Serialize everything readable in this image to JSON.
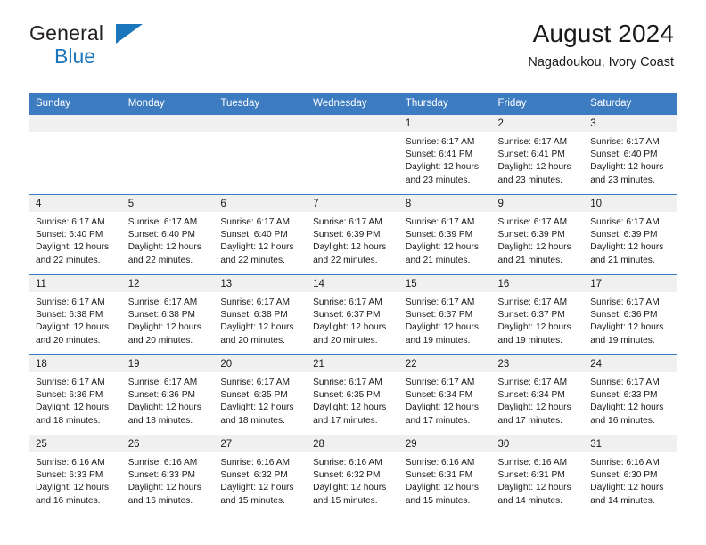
{
  "brand": {
    "name_part1": "General",
    "name_part2": "Blue"
  },
  "header": {
    "title": "August 2024",
    "location": "Nagadoukou, Ivory Coast"
  },
  "colors": {
    "header_blue": "#3e7cc1",
    "brand_blue": "#1b76bc",
    "daynum_band": "#f0f0f0"
  },
  "weekday_headers": [
    "Sunday",
    "Monday",
    "Tuesday",
    "Wednesday",
    "Thursday",
    "Friday",
    "Saturday"
  ],
  "weeks": [
    [
      {
        "day": "",
        "sunrise": "",
        "sunset": "",
        "daylight1": "",
        "daylight2": ""
      },
      {
        "day": "",
        "sunrise": "",
        "sunset": "",
        "daylight1": "",
        "daylight2": ""
      },
      {
        "day": "",
        "sunrise": "",
        "sunset": "",
        "daylight1": "",
        "daylight2": ""
      },
      {
        "day": "",
        "sunrise": "",
        "sunset": "",
        "daylight1": "",
        "daylight2": ""
      },
      {
        "day": "1",
        "sunrise": "Sunrise: 6:17 AM",
        "sunset": "Sunset: 6:41 PM",
        "daylight1": "Daylight: 12 hours",
        "daylight2": "and 23 minutes."
      },
      {
        "day": "2",
        "sunrise": "Sunrise: 6:17 AM",
        "sunset": "Sunset: 6:41 PM",
        "daylight1": "Daylight: 12 hours",
        "daylight2": "and 23 minutes."
      },
      {
        "day": "3",
        "sunrise": "Sunrise: 6:17 AM",
        "sunset": "Sunset: 6:40 PM",
        "daylight1": "Daylight: 12 hours",
        "daylight2": "and 23 minutes."
      }
    ],
    [
      {
        "day": "4",
        "sunrise": "Sunrise: 6:17 AM",
        "sunset": "Sunset: 6:40 PM",
        "daylight1": "Daylight: 12 hours",
        "daylight2": "and 22 minutes."
      },
      {
        "day": "5",
        "sunrise": "Sunrise: 6:17 AM",
        "sunset": "Sunset: 6:40 PM",
        "daylight1": "Daylight: 12 hours",
        "daylight2": "and 22 minutes."
      },
      {
        "day": "6",
        "sunrise": "Sunrise: 6:17 AM",
        "sunset": "Sunset: 6:40 PM",
        "daylight1": "Daylight: 12 hours",
        "daylight2": "and 22 minutes."
      },
      {
        "day": "7",
        "sunrise": "Sunrise: 6:17 AM",
        "sunset": "Sunset: 6:39 PM",
        "daylight1": "Daylight: 12 hours",
        "daylight2": "and 22 minutes."
      },
      {
        "day": "8",
        "sunrise": "Sunrise: 6:17 AM",
        "sunset": "Sunset: 6:39 PM",
        "daylight1": "Daylight: 12 hours",
        "daylight2": "and 21 minutes."
      },
      {
        "day": "9",
        "sunrise": "Sunrise: 6:17 AM",
        "sunset": "Sunset: 6:39 PM",
        "daylight1": "Daylight: 12 hours",
        "daylight2": "and 21 minutes."
      },
      {
        "day": "10",
        "sunrise": "Sunrise: 6:17 AM",
        "sunset": "Sunset: 6:39 PM",
        "daylight1": "Daylight: 12 hours",
        "daylight2": "and 21 minutes."
      }
    ],
    [
      {
        "day": "11",
        "sunrise": "Sunrise: 6:17 AM",
        "sunset": "Sunset: 6:38 PM",
        "daylight1": "Daylight: 12 hours",
        "daylight2": "and 20 minutes."
      },
      {
        "day": "12",
        "sunrise": "Sunrise: 6:17 AM",
        "sunset": "Sunset: 6:38 PM",
        "daylight1": "Daylight: 12 hours",
        "daylight2": "and 20 minutes."
      },
      {
        "day": "13",
        "sunrise": "Sunrise: 6:17 AM",
        "sunset": "Sunset: 6:38 PM",
        "daylight1": "Daylight: 12 hours",
        "daylight2": "and 20 minutes."
      },
      {
        "day": "14",
        "sunrise": "Sunrise: 6:17 AM",
        "sunset": "Sunset: 6:37 PM",
        "daylight1": "Daylight: 12 hours",
        "daylight2": "and 20 minutes."
      },
      {
        "day": "15",
        "sunrise": "Sunrise: 6:17 AM",
        "sunset": "Sunset: 6:37 PM",
        "daylight1": "Daylight: 12 hours",
        "daylight2": "and 19 minutes."
      },
      {
        "day": "16",
        "sunrise": "Sunrise: 6:17 AM",
        "sunset": "Sunset: 6:37 PM",
        "daylight1": "Daylight: 12 hours",
        "daylight2": "and 19 minutes."
      },
      {
        "day": "17",
        "sunrise": "Sunrise: 6:17 AM",
        "sunset": "Sunset: 6:36 PM",
        "daylight1": "Daylight: 12 hours",
        "daylight2": "and 19 minutes."
      }
    ],
    [
      {
        "day": "18",
        "sunrise": "Sunrise: 6:17 AM",
        "sunset": "Sunset: 6:36 PM",
        "daylight1": "Daylight: 12 hours",
        "daylight2": "and 18 minutes."
      },
      {
        "day": "19",
        "sunrise": "Sunrise: 6:17 AM",
        "sunset": "Sunset: 6:36 PM",
        "daylight1": "Daylight: 12 hours",
        "daylight2": "and 18 minutes."
      },
      {
        "day": "20",
        "sunrise": "Sunrise: 6:17 AM",
        "sunset": "Sunset: 6:35 PM",
        "daylight1": "Daylight: 12 hours",
        "daylight2": "and 18 minutes."
      },
      {
        "day": "21",
        "sunrise": "Sunrise: 6:17 AM",
        "sunset": "Sunset: 6:35 PM",
        "daylight1": "Daylight: 12 hours",
        "daylight2": "and 17 minutes."
      },
      {
        "day": "22",
        "sunrise": "Sunrise: 6:17 AM",
        "sunset": "Sunset: 6:34 PM",
        "daylight1": "Daylight: 12 hours",
        "daylight2": "and 17 minutes."
      },
      {
        "day": "23",
        "sunrise": "Sunrise: 6:17 AM",
        "sunset": "Sunset: 6:34 PM",
        "daylight1": "Daylight: 12 hours",
        "daylight2": "and 17 minutes."
      },
      {
        "day": "24",
        "sunrise": "Sunrise: 6:17 AM",
        "sunset": "Sunset: 6:33 PM",
        "daylight1": "Daylight: 12 hours",
        "daylight2": "and 16 minutes."
      }
    ],
    [
      {
        "day": "25",
        "sunrise": "Sunrise: 6:16 AM",
        "sunset": "Sunset: 6:33 PM",
        "daylight1": "Daylight: 12 hours",
        "daylight2": "and 16 minutes."
      },
      {
        "day": "26",
        "sunrise": "Sunrise: 6:16 AM",
        "sunset": "Sunset: 6:33 PM",
        "daylight1": "Daylight: 12 hours",
        "daylight2": "and 16 minutes."
      },
      {
        "day": "27",
        "sunrise": "Sunrise: 6:16 AM",
        "sunset": "Sunset: 6:32 PM",
        "daylight1": "Daylight: 12 hours",
        "daylight2": "and 15 minutes."
      },
      {
        "day": "28",
        "sunrise": "Sunrise: 6:16 AM",
        "sunset": "Sunset: 6:32 PM",
        "daylight1": "Daylight: 12 hours",
        "daylight2": "and 15 minutes."
      },
      {
        "day": "29",
        "sunrise": "Sunrise: 6:16 AM",
        "sunset": "Sunset: 6:31 PM",
        "daylight1": "Daylight: 12 hours",
        "daylight2": "and 15 minutes."
      },
      {
        "day": "30",
        "sunrise": "Sunrise: 6:16 AM",
        "sunset": "Sunset: 6:31 PM",
        "daylight1": "Daylight: 12 hours",
        "daylight2": "and 14 minutes."
      },
      {
        "day": "31",
        "sunrise": "Sunrise: 6:16 AM",
        "sunset": "Sunset: 6:30 PM",
        "daylight1": "Daylight: 12 hours",
        "daylight2": "and 14 minutes."
      }
    ]
  ]
}
